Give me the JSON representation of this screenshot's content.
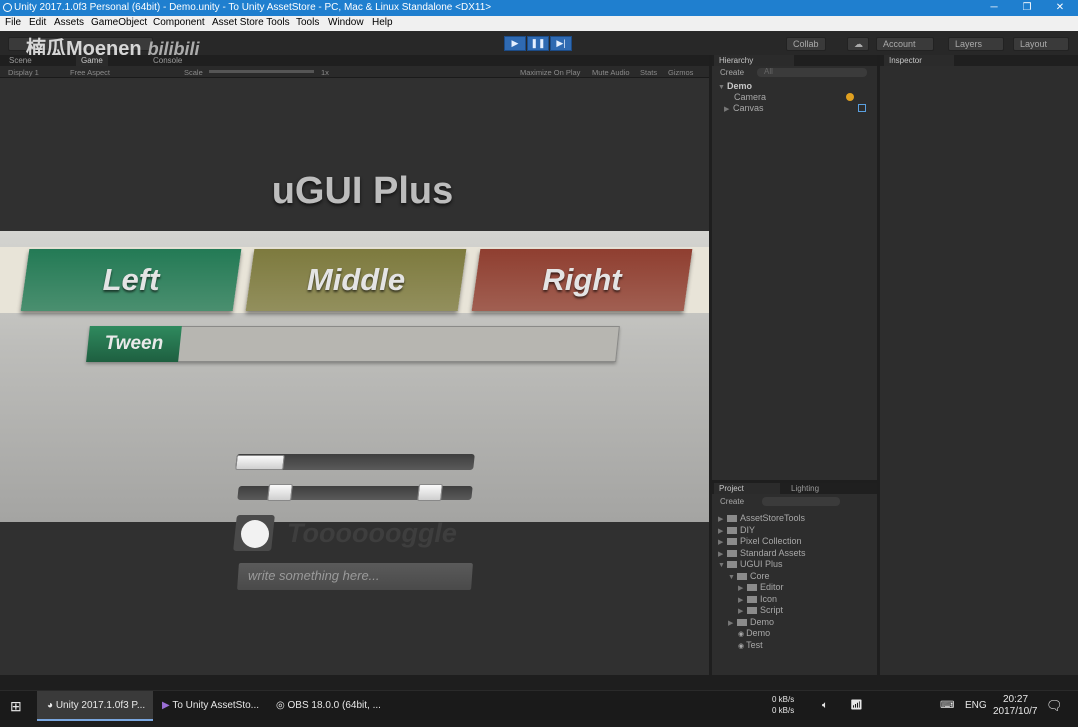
{
  "window": {
    "title": "Unity 2017.1.0f3 Personal (64bit) - Demo.unity - To Unity AssetStore - PC, Mac & Linux Standalone <DX11>",
    "minimize": "─",
    "restore": "❐",
    "close": "✕"
  },
  "menu": [
    "File",
    "Edit",
    "Assets",
    "GameObject",
    "Component",
    "Asset Store Tools",
    "Tools",
    "Window",
    "Help"
  ],
  "toolbar": {
    "watermark": "楠瓜Moenen",
    "watermark_logo": "bilibili",
    "collab": "Collab",
    "account": "Account",
    "layers": "Layers",
    "layout": "Layout",
    "play_icon": "▶",
    "pause_icon": "❚❚",
    "step_icon": "▶|"
  },
  "game_panel": {
    "tabs": [
      "Scene",
      "Game",
      "Console"
    ],
    "display": "Display 1",
    "aspect": "Free Aspect",
    "scale_label": "Scale",
    "scale_value": "1x",
    "maximize_on_play": "Maximize On Play",
    "mute_audio": "Mute Audio",
    "stats": "Stats",
    "gizmos": "Gizmos"
  },
  "game_view": {
    "title": "uGUI Plus",
    "segments": [
      {
        "label": "Left",
        "color": "#237a55"
      },
      {
        "label": "Middle",
        "color": "#7d7a3e"
      },
      {
        "label": "Right",
        "color": "#8f3e30"
      }
    ],
    "tween_label": "Tween",
    "progress_value": 0.2,
    "range_min": 0.2,
    "range_max": 0.8,
    "toggle_label": "Tooooooggle",
    "input_placeholder": "write something here..."
  },
  "hierarchy": {
    "tab": "Hierarchy",
    "create": "Create",
    "search_placeholder": "All",
    "scene": "Demo",
    "items": [
      "Camera",
      "Canvas"
    ]
  },
  "inspector": {
    "tab": "Inspector"
  },
  "project": {
    "tabs": [
      "Project",
      "Lighting"
    ],
    "create": "Create",
    "items": [
      {
        "label": "AssetStoreTools"
      },
      {
        "label": "DIY"
      },
      {
        "label": "Pixel Collection"
      },
      {
        "label": "Standard Assets"
      },
      {
        "label": "UGUI Plus"
      },
      {
        "label": "Core"
      },
      {
        "label": "Editor"
      },
      {
        "label": "Icon"
      },
      {
        "label": "Script"
      },
      {
        "label": "Demo"
      },
      {
        "label": "Demo"
      },
      {
        "label": "Test"
      }
    ]
  },
  "taskbar": {
    "apps": [
      "Unity 2017.1.0f3 P...",
      "To Unity AssetSto...",
      "OBS 18.0.0 (64bit, ..."
    ],
    "net_up": "0 kB/s",
    "net_down": "0 kB/s",
    "lang": "ENG",
    "time": "20:27",
    "date": "2017/10/7"
  }
}
